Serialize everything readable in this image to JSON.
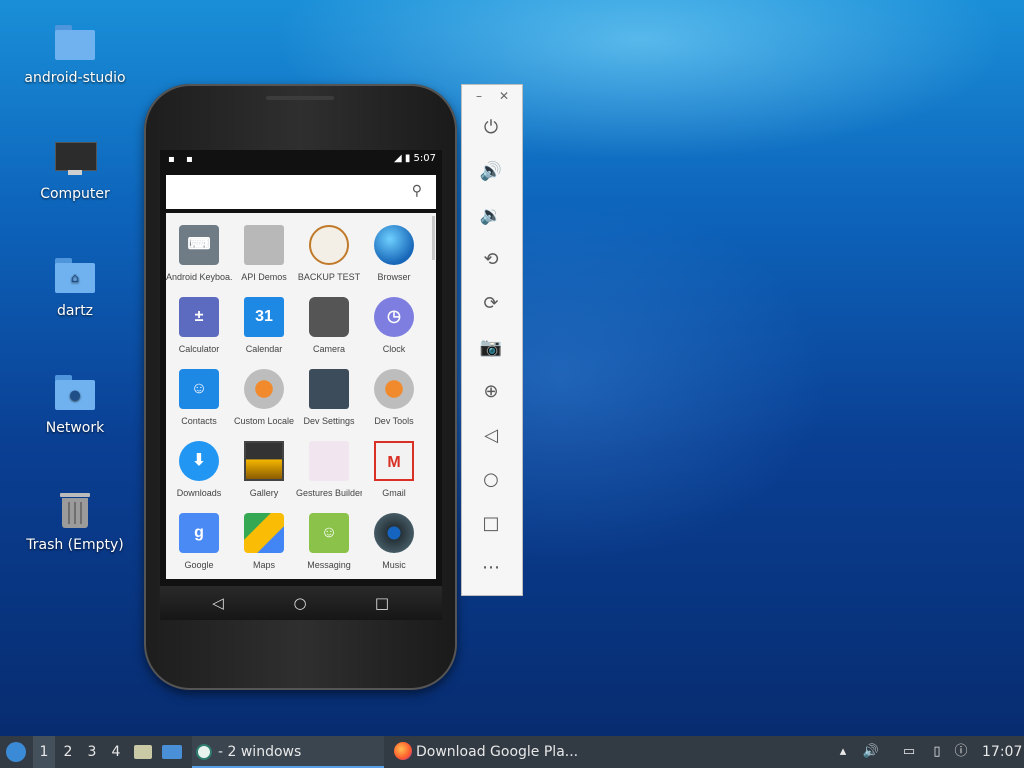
{
  "desktop": {
    "icons": [
      {
        "label": "android-studio",
        "icon": "folder-icon"
      },
      {
        "label": "Computer",
        "icon": "computer-icon"
      },
      {
        "label": "dartz",
        "icon": "home-folder-icon"
      },
      {
        "label": "Network",
        "icon": "network-folder-icon"
      },
      {
        "label": "Trash (Empty)",
        "icon": "trash-icon"
      }
    ]
  },
  "phone": {
    "status": {
      "time": "5:07"
    },
    "search": {
      "icon": "search-icon"
    },
    "apps": [
      {
        "label": "Android Keyboa...",
        "icon": "keyboard-icon"
      },
      {
        "label": "API Demos",
        "icon": "folder-gear-icon"
      },
      {
        "label": "BACKUP TEST",
        "icon": "sheep-icon"
      },
      {
        "label": "Browser",
        "icon": "globe-icon"
      },
      {
        "label": "Calculator",
        "icon": "calculator-icon"
      },
      {
        "label": "Calendar",
        "icon": "calendar-icon",
        "badge": "31"
      },
      {
        "label": "Camera",
        "icon": "camera-icon"
      },
      {
        "label": "Clock",
        "icon": "clock-icon"
      },
      {
        "label": "Contacts",
        "icon": "contacts-icon"
      },
      {
        "label": "Custom Locale",
        "icon": "gear-icon"
      },
      {
        "label": "Dev Settings",
        "icon": "sliders-icon"
      },
      {
        "label": "Dev Tools",
        "icon": "gear-icon"
      },
      {
        "label": "Downloads",
        "icon": "download-icon"
      },
      {
        "label": "Gallery",
        "icon": "gallery-icon"
      },
      {
        "label": "Gestures Builder",
        "icon": "gestures-icon"
      },
      {
        "label": "Gmail",
        "icon": "gmail-icon"
      },
      {
        "label": "Google",
        "icon": "google-icon"
      },
      {
        "label": "Maps",
        "icon": "maps-icon"
      },
      {
        "label": "Messaging",
        "icon": "messaging-icon"
      },
      {
        "label": "Music",
        "icon": "music-icon"
      }
    ],
    "nav": [
      "back-icon",
      "home-icon",
      "recents-icon"
    ]
  },
  "emulator_toolbar": {
    "tools": [
      "power-icon",
      "volume-up-icon",
      "volume-down-icon",
      "rotate-left-icon",
      "rotate-right-icon",
      "screenshot-icon",
      "zoom-icon",
      "back-icon",
      "home-icon",
      "overview-icon",
      "more-icon"
    ]
  },
  "taskbar": {
    "workspaces": [
      "1",
      "2",
      "3",
      "4"
    ],
    "active_workspace": "1",
    "tasks": [
      {
        "label": "- 2 windows",
        "icon": "android-studio-icon"
      },
      {
        "label": "Download Google Pla...",
        "icon": "firefox-icon"
      }
    ],
    "clock": "17:07"
  }
}
